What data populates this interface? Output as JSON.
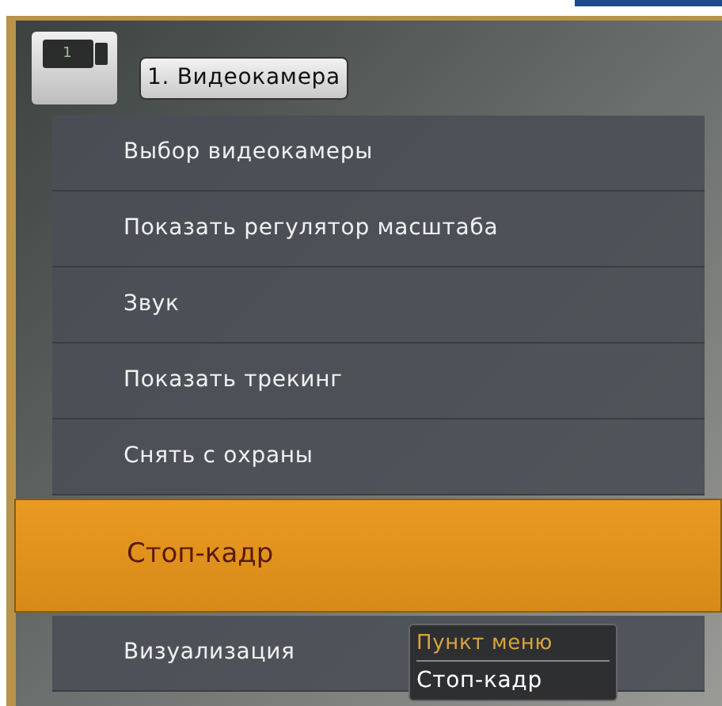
{
  "camera": {
    "number": "1",
    "label": "1. Видеокамера"
  },
  "menu": {
    "items": [
      {
        "label": "Выбор видеокамеры",
        "selected": false
      },
      {
        "label": "Показать регулятор масштаба",
        "selected": false
      },
      {
        "label": "Звук",
        "selected": false
      },
      {
        "label": "Показать трекинг",
        "selected": false
      },
      {
        "label": "Снять с охраны",
        "selected": false
      },
      {
        "label": "Стоп-кадр",
        "selected": true
      },
      {
        "label": "Визуализация",
        "selected": false
      }
    ]
  },
  "tooltip": {
    "title": "Пункт меню",
    "value": "Стоп-кадр"
  }
}
